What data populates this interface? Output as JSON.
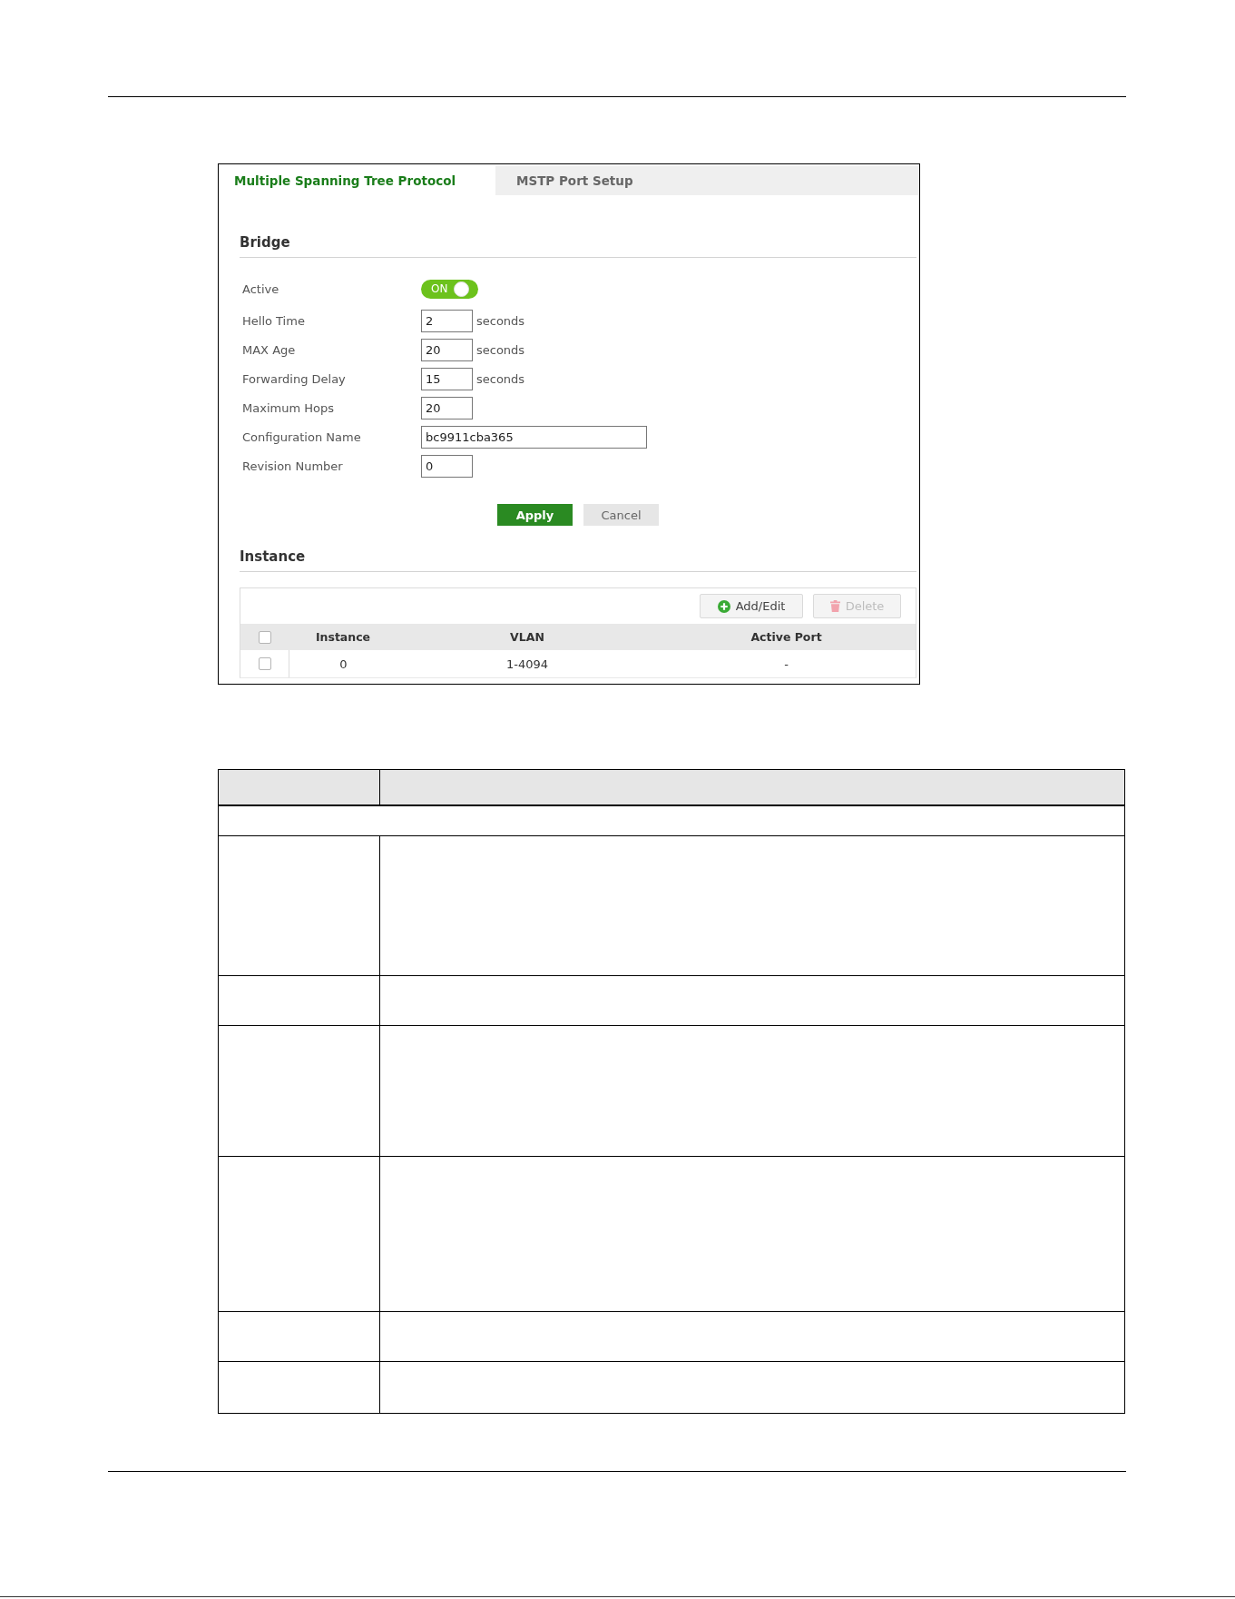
{
  "tabs": [
    {
      "label": "Multiple Spanning Tree Protocol",
      "selected": true
    },
    {
      "label": "MSTP Port Setup",
      "selected": false
    }
  ],
  "bridge": {
    "title": "Bridge",
    "fields": [
      {
        "kind": "toggle",
        "label": "Active",
        "on": true,
        "text": "ON"
      },
      {
        "kind": "number",
        "label": "Hello Time",
        "value": "2",
        "unit": "seconds"
      },
      {
        "kind": "number",
        "label": "MAX Age",
        "value": "20",
        "unit": "seconds"
      },
      {
        "kind": "number",
        "label": "Forwarding Delay",
        "value": "15",
        "unit": "seconds"
      },
      {
        "kind": "number",
        "label": "Maximum Hops",
        "value": "20"
      },
      {
        "kind": "text",
        "label": "Configuration Name",
        "value": "bc9911cba365"
      },
      {
        "kind": "number",
        "label": "Revision Number",
        "value": "0"
      }
    ]
  },
  "form_buttons": [
    {
      "kind": "primary",
      "label": "Apply"
    },
    {
      "kind": "secondary",
      "label": "Cancel"
    }
  ],
  "instance": {
    "title": "Instance",
    "toolbar": [
      {
        "kind": "add",
        "label": "Add/Edit",
        "disabled": false
      },
      {
        "kind": "delete",
        "label": "Delete",
        "disabled": true
      }
    ],
    "columns": [
      "Instance",
      "VLAN",
      "Active Port"
    ],
    "select_all_checked": false,
    "rows": [
      {
        "checked": false,
        "cells": [
          "0",
          "1-4094",
          "-"
        ]
      }
    ]
  },
  "description_table": {
    "rows": [
      {
        "kind": "header"
      },
      {
        "kind": "section"
      },
      {
        "kind": "entry"
      },
      {
        "kind": "entry"
      },
      {
        "kind": "entry"
      },
      {
        "kind": "entry"
      },
      {
        "kind": "entry"
      },
      {
        "kind": "entry"
      }
    ]
  }
}
